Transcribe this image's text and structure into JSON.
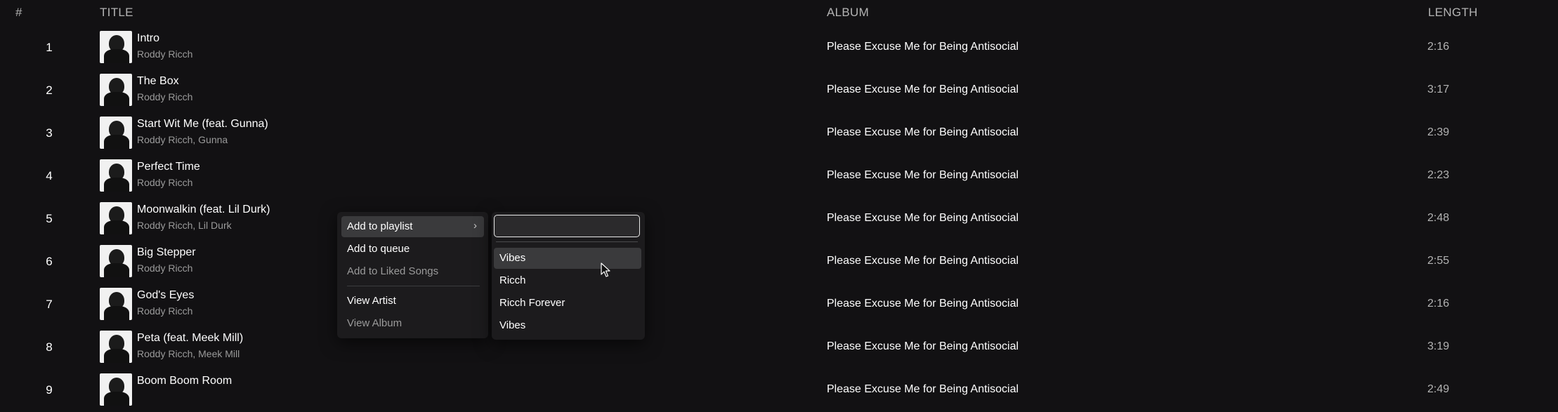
{
  "header": {
    "num": "#",
    "title": "TITLE",
    "album": "ALBUM",
    "length": "LENGTH"
  },
  "tracks": [
    {
      "num": "1",
      "title": "Intro",
      "artist": "Roddy Ricch",
      "album": "Please Excuse Me for Being Antisocial",
      "length": "2:16"
    },
    {
      "num": "2",
      "title": "The Box",
      "artist": "Roddy Ricch",
      "album": "Please Excuse Me for Being Antisocial",
      "length": "3:17"
    },
    {
      "num": "3",
      "title": "Start Wit Me (feat. Gunna)",
      "artist": "Roddy Ricch, Gunna",
      "album": "Please Excuse Me for Being Antisocial",
      "length": "2:39"
    },
    {
      "num": "4",
      "title": "Perfect Time",
      "artist": "Roddy Ricch",
      "album": "Please Excuse Me for Being Antisocial",
      "length": "2:23"
    },
    {
      "num": "5",
      "title": "Moonwalkin (feat. Lil Durk)",
      "artist": "Roddy Ricch, Lil Durk",
      "album": "Please Excuse Me for Being Antisocial",
      "length": "2:48"
    },
    {
      "num": "6",
      "title": "Big Stepper",
      "artist": "Roddy Ricch",
      "album": "Please Excuse Me for Being Antisocial",
      "length": "2:55"
    },
    {
      "num": "7",
      "title": "God's Eyes",
      "artist": "Roddy Ricch",
      "album": "Please Excuse Me for Being Antisocial",
      "length": "2:16"
    },
    {
      "num": "8",
      "title": "Peta (feat. Meek Mill)",
      "artist": "Roddy Ricch, Meek Mill",
      "album": "Please Excuse Me for Being Antisocial",
      "length": "3:19"
    },
    {
      "num": "9",
      "title": "Boom Boom Room",
      "artist": "",
      "album": "Please Excuse Me for Being Antisocial",
      "length": "2:49"
    }
  ],
  "context_menu": {
    "add_to_playlist": "Add to playlist",
    "chevron": "›",
    "add_to_queue": "Add to queue",
    "add_to_liked": "Add to Liked Songs",
    "view_artist": "View Artist",
    "view_album": "View Album"
  },
  "playlist_submenu": {
    "search_value": "",
    "items": [
      "Vibes",
      "Ricch",
      "Ricch Forever",
      "Vibes"
    ]
  },
  "icons": {
    "album_art": "album-cover-image",
    "cursor": "mouse-pointer-icon"
  },
  "colors": {
    "background": "#121113",
    "menu": "#1c1b1d",
    "highlight": "#3a3a3c",
    "muted": "#9a9a9a"
  }
}
